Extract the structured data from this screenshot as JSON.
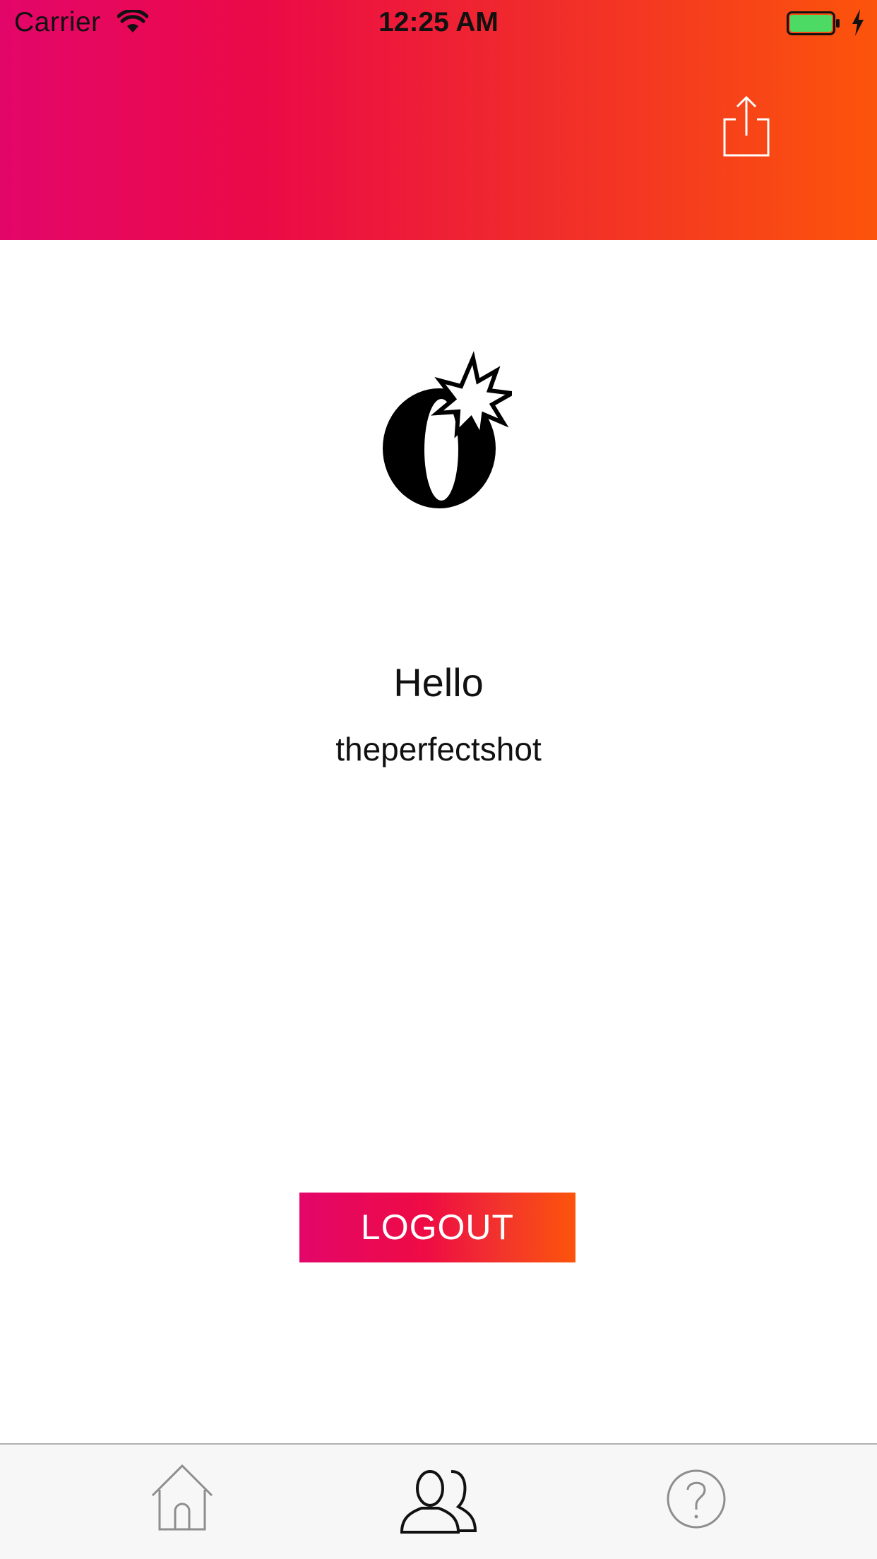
{
  "status_bar": {
    "carrier": "Carrier",
    "time": "12:25 AM",
    "battery_color": "#4cd964",
    "icons": [
      "wifi-icon",
      "battery-icon",
      "charging-bolt-icon"
    ]
  },
  "header": {
    "gradient_start": "#e3066a",
    "gradient_end": "#fc540b",
    "share_icon": "share-icon"
  },
  "logo": {
    "letter": "O",
    "icon": "bomb-logo-icon"
  },
  "profile": {
    "greeting": "Hello",
    "username": "theperfectshot"
  },
  "logout_button": {
    "label": "LOGOUT"
  },
  "tab_bar": {
    "tabs": [
      {
        "icon": "home-icon",
        "active": false
      },
      {
        "icon": "users-icon",
        "active": true
      },
      {
        "icon": "help-icon",
        "active": false
      }
    ]
  }
}
